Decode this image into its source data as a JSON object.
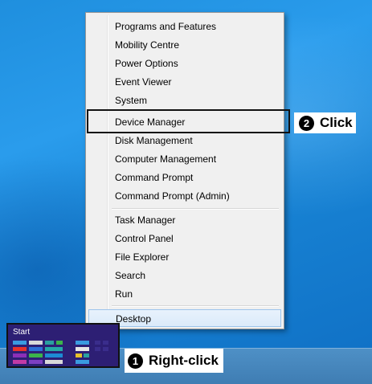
{
  "context_menu": {
    "items": [
      {
        "label": "Programs and Features"
      },
      {
        "label": "Mobility Centre"
      },
      {
        "label": "Power Options"
      },
      {
        "label": "Event Viewer"
      },
      {
        "label": "System"
      },
      {
        "label": "Device Manager"
      },
      {
        "label": "Disk Management"
      },
      {
        "label": "Computer Management"
      },
      {
        "label": "Command Prompt"
      },
      {
        "label": "Command Prompt (Admin)"
      },
      {
        "label": "Task Manager"
      },
      {
        "label": "Control Panel"
      },
      {
        "label": "File Explorer"
      },
      {
        "label": "Search"
      },
      {
        "label": "Run"
      },
      {
        "label": "Desktop"
      }
    ]
  },
  "start_screen": {
    "label": "Start"
  },
  "callouts": {
    "step1": {
      "number": "1",
      "text": "Right-click"
    },
    "step2": {
      "number": "2",
      "text": "Click"
    }
  },
  "colors": {
    "desktop_blue": "#1f8fde",
    "menu_background": "#f0f0f0",
    "highlight": "#dbeafa",
    "start_screen_purple": "#2d1f74"
  }
}
